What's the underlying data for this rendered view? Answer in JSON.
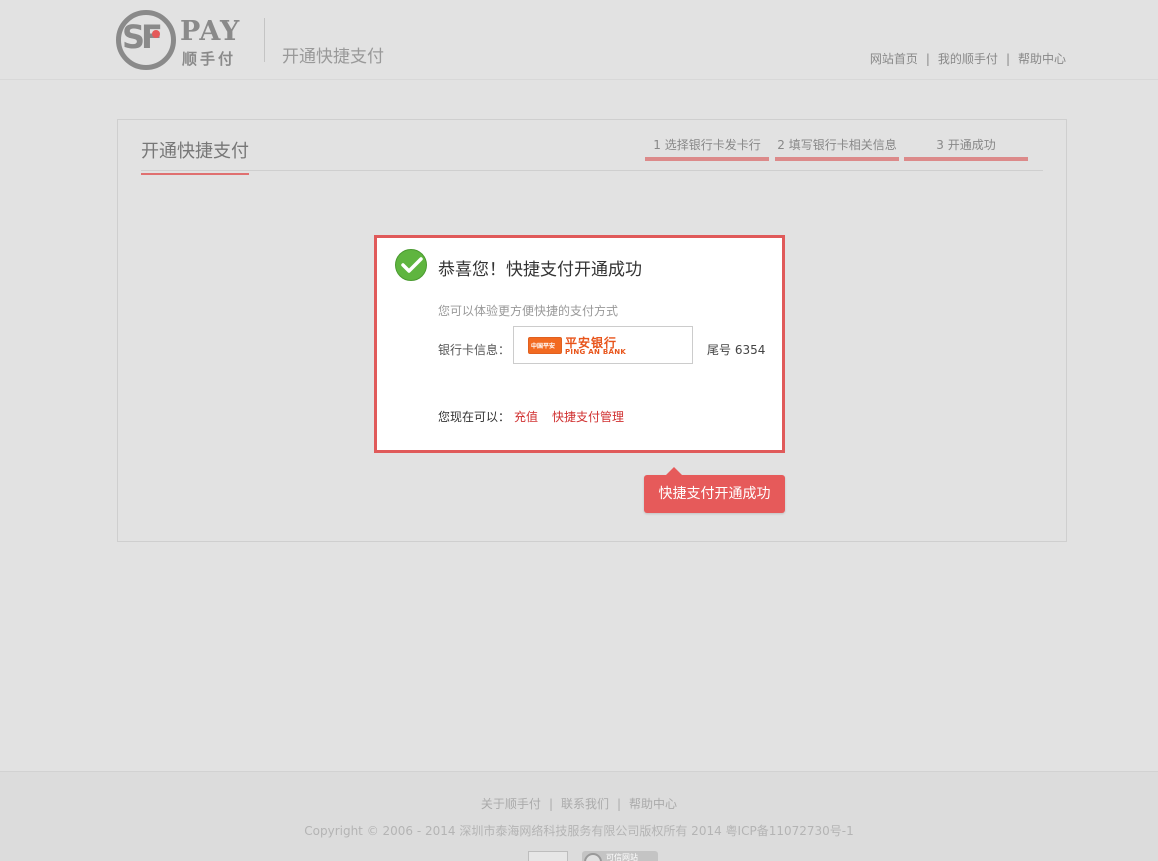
{
  "header": {
    "logo": {
      "mark": "SF",
      "pay": "PAY",
      "cn": "顺手付"
    },
    "title": "开通快捷支付",
    "nav": [
      "网站首页",
      "我的顺手付",
      "帮助中心"
    ],
    "nav_sep": "|"
  },
  "panel": {
    "title": "开通快捷支付",
    "steps": [
      "1 选择银行卡发卡行",
      "2 填写银行卡相关信息",
      "3 开通成功"
    ]
  },
  "success": {
    "title": "恭喜您！快捷支付开通成功",
    "subtitle": "您可以体验更方便快捷的支付方式",
    "card_label": "银行卡信息：",
    "bank": {
      "badge": "中国平安",
      "name_cn": "平安银行",
      "name_en": "PING AN BANK"
    },
    "card_tail": "尾号 6354",
    "now_label": "您现在可以：",
    "links": [
      "充值",
      "快捷支付管理"
    ]
  },
  "tooltip": {
    "text": "快捷支付开通成功"
  },
  "footer": {
    "links": [
      "关于顺手付",
      "联系我们",
      "帮助中心"
    ],
    "sep": "|",
    "copyright": "Copyright © 2006 - 2014 深圳市泰海网络科技服务有限公司版权所有 2014 粤ICP备11072730号-1",
    "badge_text": "可信网站"
  },
  "colors": {
    "accent": "#e05a5a",
    "check": "#5fb53f",
    "bank": "#e8541a",
    "background": "#e2e2e2"
  },
  "icons": [
    "check-circle-icon"
  ]
}
